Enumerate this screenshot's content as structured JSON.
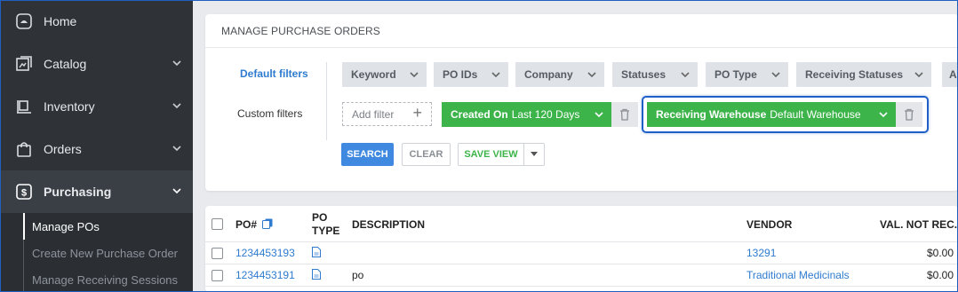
{
  "sidebar": {
    "items": [
      {
        "label": "Home",
        "icon": "home-icon"
      },
      {
        "label": "Catalog",
        "icon": "catalog-icon"
      },
      {
        "label": "Inventory",
        "icon": "inventory-icon"
      },
      {
        "label": "Orders",
        "icon": "orders-icon"
      },
      {
        "label": "Purchasing",
        "icon": "purchasing-icon"
      }
    ],
    "sub_items": [
      {
        "label": "Manage POs"
      },
      {
        "label": "Create New Purchase Order"
      },
      {
        "label": "Manage Receiving Sessions"
      }
    ]
  },
  "filters": {
    "title": "MANAGE PURCHASE ORDERS",
    "default_label": "Default filters",
    "custom_label": "Custom filters",
    "default_chips": [
      "Keyword",
      "PO IDs",
      "Company",
      "Statuses",
      "PO Type",
      "Receiving Statuses",
      "A"
    ],
    "add_filter": "Add filter",
    "created_on": {
      "name": "Created On",
      "value": "Last 120 Days"
    },
    "receiving_warehouse": {
      "name": "Receiving Warehouse",
      "value": "Default Warehouse"
    },
    "buttons": {
      "search": "SEARCH",
      "clear": "CLEAR",
      "save_view": "SAVE VIEW"
    }
  },
  "table": {
    "headers": {
      "po": "PO#",
      "po_type_1": "PO",
      "po_type_2": "TYPE",
      "description": "DESCRIPTION",
      "vendor": "VENDOR",
      "val": "VAL. NOT REC."
    },
    "rows": [
      {
        "po": "1234453193",
        "description": "",
        "vendor": "13291",
        "val": "$0.00"
      },
      {
        "po": "1234453191",
        "description": "po",
        "vendor": "Traditional Medicinals",
        "val": "$0.00"
      }
    ]
  },
  "colors": {
    "accent": "#2e7bcf",
    "green": "#3cb44a",
    "sidebar": "#2f3338",
    "highlight": "#1f5fc6"
  }
}
